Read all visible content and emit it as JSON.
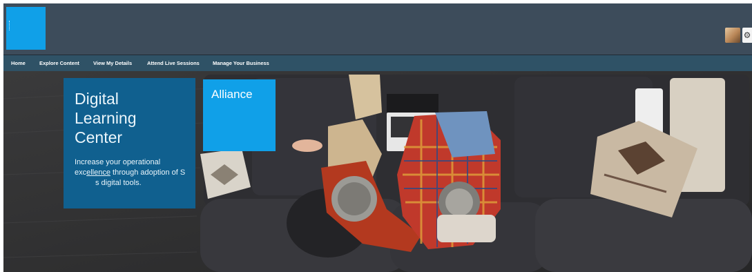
{
  "header": {
    "logo_icon": "brand-logo-icon",
    "avatar_icon": "user-avatar-icon",
    "settings_icon": "gear-icon"
  },
  "nav": {
    "items": [
      {
        "label": "Home"
      },
      {
        "label": "Explore Content"
      },
      {
        "label": "View My Details"
      },
      {
        "label": "Attend Live Sessions"
      },
      {
        "label": "Manage Your Business"
      }
    ]
  },
  "hero": {
    "title_line1": "Digital",
    "title_line2": "Learning",
    "title_line3": "Center",
    "desc_part1": "Increase your operational exc",
    "desc_underlined": "ellence",
    "desc_part2": " through adoption of S",
    "desc_part3": "s digital tools.",
    "badge": "Alliance"
  },
  "colors": {
    "header_bg": "#3d4c5b",
    "nav_bg": "#2f5266",
    "brand_blue": "#10a0e8",
    "card_blue": "#10608f"
  }
}
